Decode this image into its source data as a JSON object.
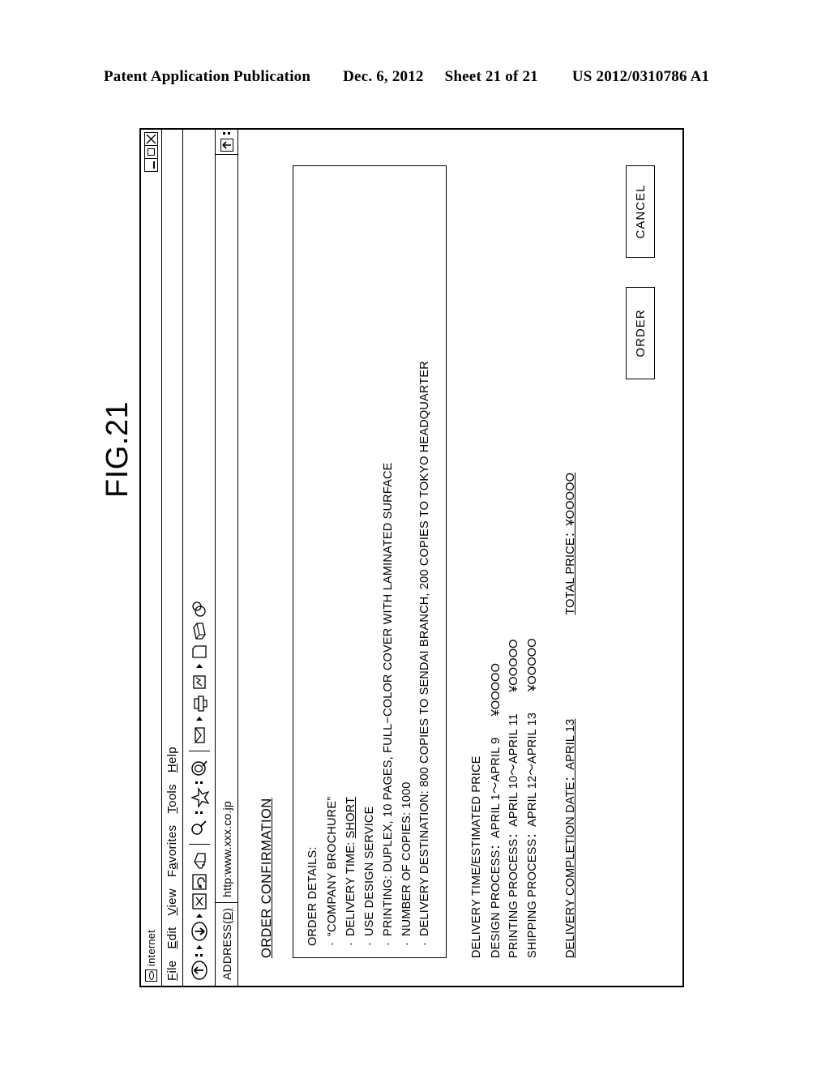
{
  "patent_header": {
    "title": "Patent Application Publication",
    "date": "Dec. 6, 2012",
    "sheet": "Sheet 21 of 21",
    "publication_number": "US 2012/0310786 A1"
  },
  "figure": {
    "label": "FIG.21"
  },
  "browser": {
    "window_title": "internet",
    "window_controls": {
      "minimize": "minimize",
      "maximize": "maximize",
      "close": "close"
    },
    "menu": [
      {
        "label": "File",
        "accel": "F"
      },
      {
        "label": "Edit",
        "accel": "E"
      },
      {
        "label": "View",
        "accel": "V"
      },
      {
        "label": "Favorites",
        "accel": "a"
      },
      {
        "label": "Tools",
        "accel": "T"
      },
      {
        "label": "Help",
        "accel": "H"
      }
    ],
    "toolbar": [
      {
        "name": "back-icon"
      },
      {
        "name": "back-dropdown-caret"
      },
      {
        "name": "forward-icon"
      },
      {
        "name": "forward-dropdown-caret"
      },
      {
        "name": "stop-icon"
      },
      {
        "name": "refresh-icon"
      },
      {
        "name": "home-icon"
      },
      {
        "name": "search-icon"
      },
      {
        "name": "favorites-star-icon"
      },
      {
        "name": "history-icon"
      },
      {
        "name": "mail-icon"
      },
      {
        "name": "mail-dropdown-caret"
      },
      {
        "name": "print-icon"
      },
      {
        "name": "edit-icon"
      },
      {
        "name": "edit-dropdown-caret"
      },
      {
        "name": "page-icon"
      },
      {
        "name": "discuss-icon"
      },
      {
        "name": "messenger-icon"
      }
    ],
    "address_bar": {
      "label": "ADDRESS",
      "label_accel": "(D)",
      "url": "http:www.xxx.co.jp",
      "go_arrow": "go-icon"
    }
  },
  "content": {
    "page_title": "ORDER CONFIRMATION",
    "details": {
      "heading": "ORDER DETAILS:",
      "items": [
        {
          "bullet": "·",
          "text": "“COMPANY BROCHURE”"
        },
        {
          "bullet": "·",
          "text_prefix": "DELIVERY TIME: ",
          "text_underlined": "SHORT"
        },
        {
          "bullet": "·",
          "text": "USE DESIGN SERVICE"
        },
        {
          "bullet": "·",
          "text": "PRINTING: DUPLEX, 10 PAGES, FULL−COLOR COVER WITH LAMINATED SURFACE"
        },
        {
          "bullet": "·",
          "text": "NUMBER OF COPIES: 1000"
        },
        {
          "bullet": "·",
          "text": "DELIVERY DESTINATION: 800 COPIES TO SENDAI BRANCH, 200 COPIES TO TOKYO HEADQUARTER"
        }
      ]
    },
    "estimate": {
      "heading": "DELIVERY TIME/ESTIMATED PRICE",
      "rows": [
        {
          "label": "DESIGN PROCESS：APRIL 1～APRIL 9",
          "price": "¥OOOOO"
        },
        {
          "label": "PRINTING PROCESS：APRIL 10～APRIL 11",
          "price": "¥OOOOO"
        },
        {
          "label": "SHIPPING PROCESS：APRIL 12～APRIL 13",
          "price": "¥OOOOO"
        }
      ]
    },
    "completion_date": "DELIVERY COMPLETION DATE：APRIL 13",
    "total_price": "TOTAL PRICE：¥OOOOO",
    "buttons": {
      "order": "ORDER",
      "cancel": "CANCEL"
    }
  }
}
